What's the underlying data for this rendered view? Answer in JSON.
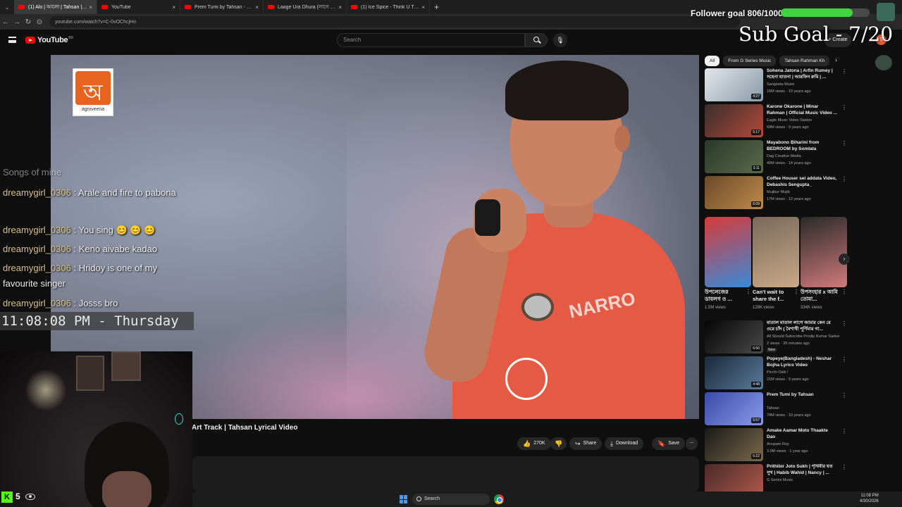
{
  "browser": {
    "tabs": [
      {
        "label": "(1) Alo | আলো | Tahsan | Alb",
        "active": true
      },
      {
        "label": "YouTube",
        "active": false
      },
      {
        "label": "Prem Tumi by Tahsan - YouTub",
        "active": false
      },
      {
        "label": "Laage Ura Dhura (লাগে উরা ধুরা",
        "active": false
      },
      {
        "label": "(1) Ice Spice - Think U The Shi",
        "active": false
      }
    ],
    "url": "youtube.com/watch?v=C-0vOChcjHo"
  },
  "youtube": {
    "logo_text": "YouTube",
    "logo_superscript": "BD",
    "search_placeholder": "Search",
    "create_label": "+ Create",
    "avatar_letter": "S"
  },
  "video": {
    "title": "Art Track | Tahsan Lyrical Video",
    "label_logo_name": "agniveena",
    "shirt_text": "NARRO",
    "like_count": "270K",
    "share_label": "Share",
    "download_label": "Download",
    "save_label": "Save"
  },
  "sidebar": {
    "chips": [
      "All",
      "From G Series Music",
      "Tahsan Rahman Kh"
    ],
    "recommendations_top": [
      {
        "title": "Sohena Jatona | Arfin Rumey | সহেনা যাতনা | আরফিন রুমি | ...",
        "channel": "Sangeeta Music",
        "meta": "16M views · 10 years ago",
        "duration": "4:27",
        "colors": [
          "#e2e6ea",
          "#8a9aa8"
        ]
      },
      {
        "title": "Karone Okarone | Minar Rahman | Official Music Video ...",
        "channel": "Eagle Music Video Station",
        "meta": "69M views · 9 years ago",
        "duration": "5:17",
        "colors": [
          "#3a2e2c",
          "#b24a3a"
        ]
      },
      {
        "title": "Mayabono Biharini from BEDROOM by Somlata",
        "channel": "Dag Creative Media",
        "meta": "40M views · 14 years ago",
        "duration": "3:11",
        "colors": [
          "#2a3a2a",
          "#5a6a4a"
        ]
      },
      {
        "title": "Coffee Houser sei addata Video, Debashis Sengupta_",
        "channel": "Mujibur Mujib",
        "meta": "17M views · 12 years ago",
        "duration": "6:09",
        "colors": [
          "#6a4a2a",
          "#c08a4a"
        ]
      }
    ],
    "shorts": [
      {
        "title": "উপলেজের ডায়লগ ও ...",
        "views": "1.5M views",
        "colors": [
          "#d83a3a",
          "#3a8ad8"
        ]
      },
      {
        "title": "Can't wait to share the f...",
        "views": "128K views",
        "colors": [
          "#7a6a5a",
          "#c8a888"
        ]
      },
      {
        "title": "উপসংহার x আমি তোমা...",
        "views": "334K views",
        "colors": [
          "#2a2a2a",
          "#d07a7a"
        ]
      }
    ],
    "recommendations_bottom": [
      {
        "title": "মাতাল মাতাল লাগে আমার কেন রে ওরে চাঁদ ( বৈশাখী পূর্ণিমার গা...",
        "channel": "All Should Subscribe Prodip Kumar Sarker",
        "meta": "2 views · 26 minutes ago",
        "duration": "6:50",
        "colors": [
          "#050505",
          "#4a4a4a"
        ]
      },
      {
        "title": "Popeye(Bangladesh) - Neshar Bojha Lyrics Video",
        "channel": "Picchi Oshi !",
        "meta": "21M views · 9 years ago",
        "duration": "4:48",
        "colors": [
          "#1a2a3a",
          "#5a7a9a"
        ]
      },
      {
        "title": "Prem Tumi by Tahsan",
        "channel": "Tahsan",
        "meta": "74M views · 10 years ago",
        "duration": "5:57",
        "colors": [
          "#3a4aa8",
          "#8a9ae8"
        ]
      },
      {
        "title": "Amake Aamar Moto Thaakte Dao",
        "channel": "Anupam Roy",
        "meta": "3.9M views · 1 year ago",
        "duration": "5:22",
        "colors": [
          "#1a1a1a",
          "#7a6a4a"
        ]
      },
      {
        "title": "Prithibir Joto Sukh | পৃথিবীর যত সুখ | Habib Wahid | Nancy | ...",
        "channel": "G Series Music",
        "meta": "",
        "duration": "",
        "colors": [
          "#4a2a2a",
          "#b05a4a"
        ]
      }
    ],
    "new_badge": "New"
  },
  "stream": {
    "follower_goal": "Follower goal 806/1000",
    "follower_progress": 0.806,
    "sub_goal": "Sub Goal - 7/20",
    "chat_partial_line": "Songs of mine",
    "chat": [
      {
        "user": "dreamygirl_0306",
        "text": "Arale and fire to pabona"
      },
      {
        "user": "dreamygirl_0306",
        "text": "You sing 😊 😊 😊"
      },
      {
        "user": "dreamygirl_0306",
        "text": "Keno aivabe kadao"
      },
      {
        "user": "dreamygirl_0306",
        "text": "Hridoy is one of my favourite singer"
      },
      {
        "user": "dreamygirl_0306",
        "text": "Josss bro"
      }
    ],
    "clock": "11:08:08 PM - Thursday",
    "kick_letter": "K",
    "viewer_count": "5"
  },
  "taskbar": {
    "search_label": "Search",
    "time": "11:08 PM",
    "date": "4/30/2026"
  }
}
